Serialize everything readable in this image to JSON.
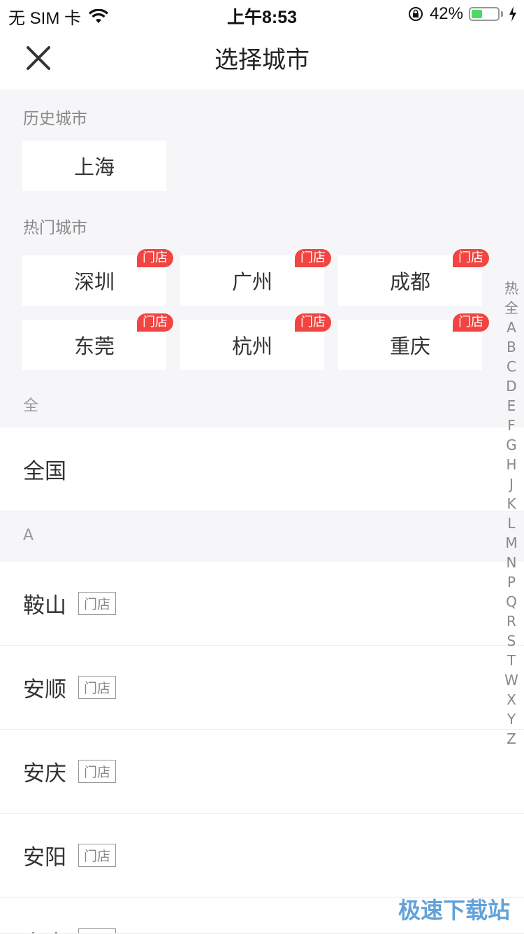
{
  "status_bar": {
    "carrier": "无 SIM 卡",
    "time": "上午8:53",
    "battery_percent_label": "42%",
    "battery_level": 0.42
  },
  "nav": {
    "title": "选择城市"
  },
  "history": {
    "label": "历史城市",
    "cities": [
      "上海"
    ]
  },
  "hot": {
    "label": "热门城市",
    "badge": "门店",
    "cities": [
      "深圳",
      "广州",
      "成都",
      "东莞",
      "杭州",
      "重庆"
    ]
  },
  "groups": [
    {
      "header": "全",
      "rows": [
        {
          "name": "全国",
          "tag": ""
        }
      ]
    },
    {
      "header": "A",
      "rows": [
        {
          "name": "鞍山",
          "tag": "门店"
        },
        {
          "name": "安顺",
          "tag": "门店"
        },
        {
          "name": "安庆",
          "tag": "门店"
        },
        {
          "name": "安阳",
          "tag": "门店"
        },
        {
          "name": "安康",
          "tag": "门店"
        }
      ]
    }
  ],
  "index_bar": [
    "热",
    "全",
    "A",
    "B",
    "C",
    "D",
    "E",
    "F",
    "G",
    "H",
    "J",
    "K",
    "L",
    "M",
    "N",
    "P",
    "Q",
    "R",
    "S",
    "T",
    "W",
    "X",
    "Y",
    "Z"
  ],
  "watermark": "极速下载站",
  "colors": {
    "badge": "#f24440",
    "battery": "#4cd964"
  }
}
